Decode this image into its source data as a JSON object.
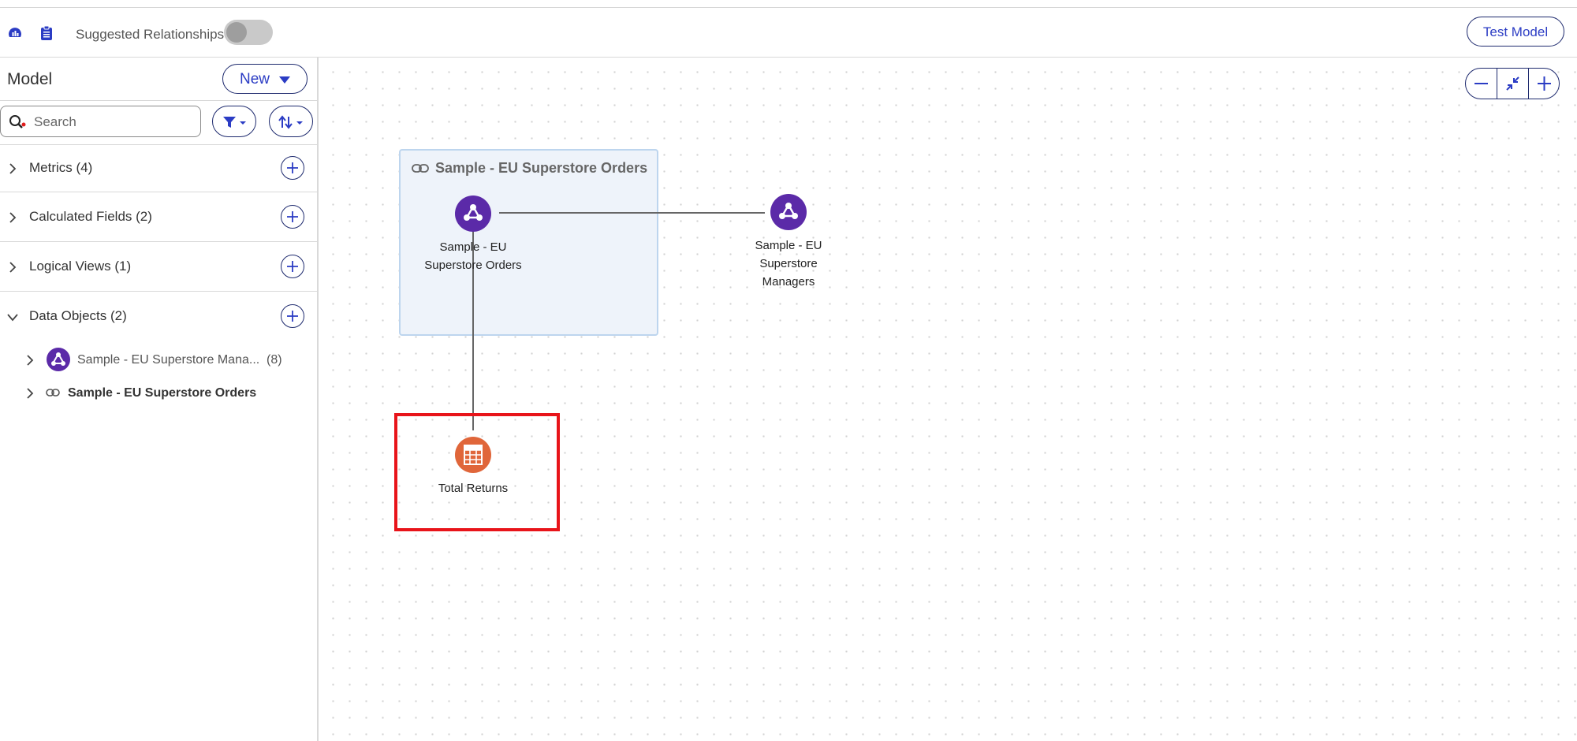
{
  "toolbar": {
    "icons": [
      "dashboard-icon",
      "clipboard-icon"
    ],
    "suggested_relationships_label": "Suggested Relationships",
    "suggested_relationships_on": false,
    "test_model_label": "Test Model"
  },
  "sidebar": {
    "title": "Model",
    "new_label": "New",
    "search": {
      "placeholder": "Search",
      "value": ""
    },
    "sections": [
      {
        "label": "Metrics (4)",
        "expanded": false
      },
      {
        "label": "Calculated Fields (2)",
        "expanded": false
      },
      {
        "label": "Logical Views (1)",
        "expanded": false
      },
      {
        "label": "Data Objects (2)",
        "expanded": true
      }
    ],
    "data_objects": [
      {
        "label": "Sample - EU Superstore Mana...",
        "count": "(8)",
        "icon": "dataset-icon",
        "bold": false
      },
      {
        "label": "Sample - EU Superstore Orders",
        "count": "",
        "icon": "link-icon",
        "bold": true
      }
    ]
  },
  "canvas": {
    "group_title": "Sample - EU Superstore Orders",
    "nodes": [
      {
        "label_lines": [
          "Sample - EU",
          "Superstore Orders"
        ],
        "icon": "dataset-icon",
        "color": "#5b2aa8"
      },
      {
        "label_lines": [
          "Sample - EU",
          "Superstore",
          "Managers"
        ],
        "icon": "dataset-icon",
        "color": "#5b2aa8"
      },
      {
        "label_lines": [
          "Total Returns"
        ],
        "icon": "table-icon",
        "color": "#e0663a"
      }
    ],
    "highlight_color": "#e8141a"
  },
  "colors": {
    "accent": "#2b3cc4",
    "border": "#1e2a6e",
    "dataset": "#5b2aa8",
    "table": "#e0663a"
  }
}
